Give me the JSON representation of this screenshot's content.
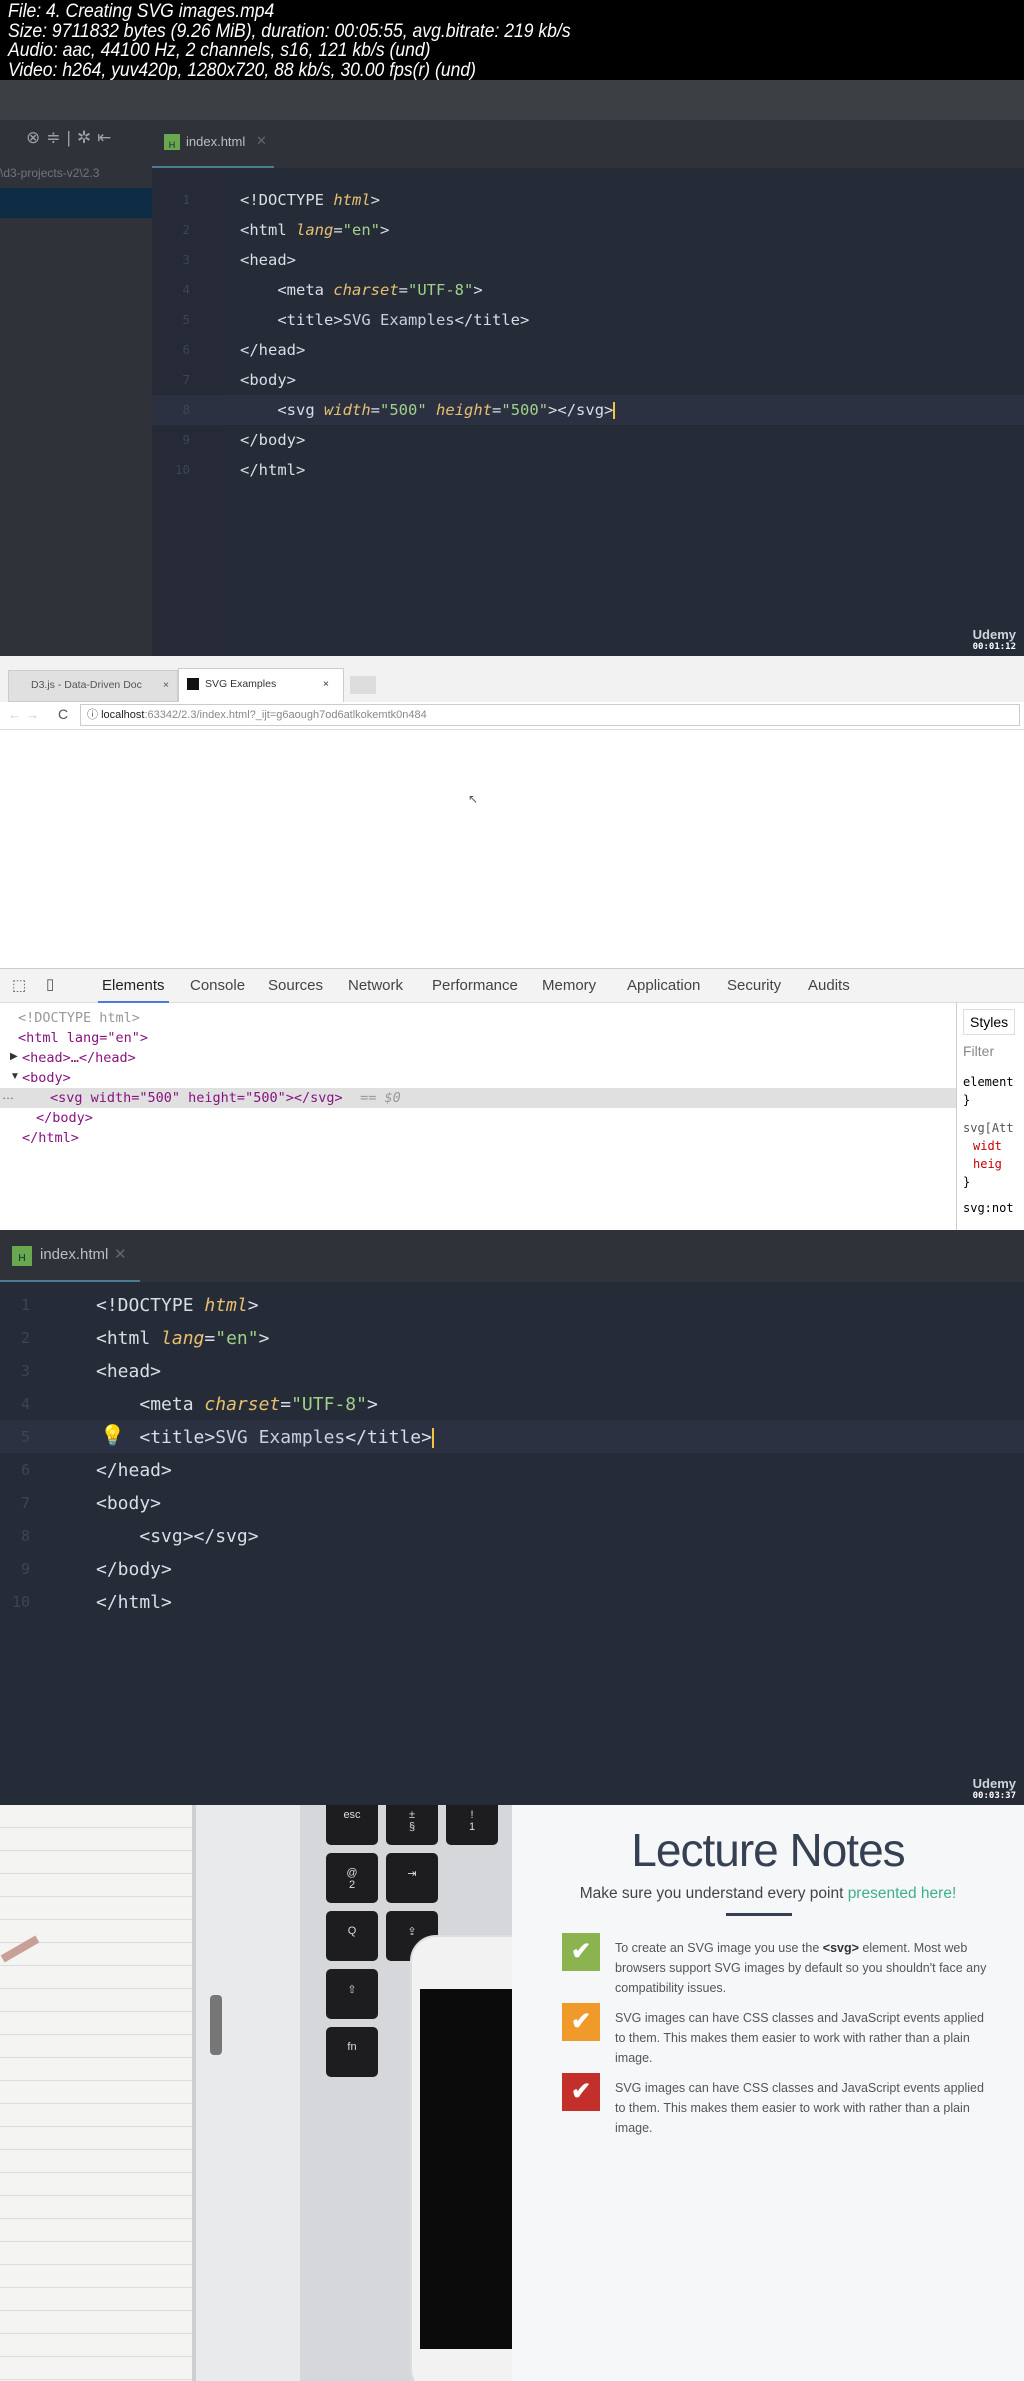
{
  "file_info": [
    "File: 4. Creating SVG images.mp4",
    "Size: 9711832 bytes (9.26 MiB), duration: 00:05:55, avg.bitrate: 219 kb/s",
    "Audio: aac, 44100 Hz, 2 channels, s16, 121 kb/s (und)",
    "Video: h264, yuv420p, 1280x720, 88 kb/s, 30.00 fps(r) (und)"
  ],
  "frame1": {
    "project_path": "\\d3-projects-v2\\2.3",
    "tab": "index.html",
    "timestamp": "00:01:12",
    "brand": "Udemy",
    "lines": [
      [
        [
          "tg",
          "<!DOCTYPE "
        ],
        [
          "at",
          "html"
        ],
        [
          "tg",
          ">"
        ]
      ],
      [
        [
          "tg",
          "<html "
        ],
        [
          "at",
          "lang"
        ],
        [
          "eq",
          "="
        ],
        [
          "st",
          "\"en\""
        ],
        [
          "tg",
          ">"
        ]
      ],
      [
        [
          "tg",
          "<head>"
        ]
      ],
      [
        [
          "tx",
          "    "
        ],
        [
          "tg",
          "<meta "
        ],
        [
          "at",
          "charset"
        ],
        [
          "eq",
          "="
        ],
        [
          "st",
          "\"UTF-8\""
        ],
        [
          "tg",
          ">"
        ]
      ],
      [
        [
          "tx",
          "    "
        ],
        [
          "tg",
          "<title>"
        ],
        [
          "tx",
          "SVG Examples"
        ],
        [
          "tg",
          "</title>"
        ]
      ],
      [
        [
          "tg",
          "</head>"
        ]
      ],
      [
        [
          "tg",
          "<body>"
        ]
      ],
      [
        [
          "tx",
          "    "
        ],
        [
          "tg",
          "<svg "
        ],
        [
          "at",
          "width"
        ],
        [
          "eq",
          "="
        ],
        [
          "st",
          "\"500\""
        ],
        [
          "tx",
          " "
        ],
        [
          "at",
          "height"
        ],
        [
          "eq",
          "="
        ],
        [
          "st",
          "\"500\""
        ],
        [
          "tg",
          "></svg>"
        ]
      ],
      [
        [
          "tg",
          "</body>"
        ]
      ],
      [
        [
          "tg",
          "</html>"
        ]
      ]
    ]
  },
  "frame2": {
    "tabs": [
      "D3.js - Data-Driven Doc",
      "SVG Examples"
    ],
    "url_host": "localhost",
    "url_rest": ":63342/2.3/index.html?_ijt=g6aough7od6atlkokemtk0n484",
    "devtools_tabs": [
      "Elements",
      "Console",
      "Sources",
      "Network",
      "Performance",
      "Memory",
      "Application",
      "Security",
      "Audits"
    ],
    "elements": {
      "doctype": "<!DOCTYPE html>",
      "html_open": "<html lang=\"en\">",
      "head": "<head>…</head>",
      "body_open": "<body>",
      "svg": "<svg width=\"500\" height=\"500\"></svg>",
      "svg_marker": " == $0",
      "body_close": "</body>",
      "html_close": "</html>"
    },
    "styles": {
      "tab": "Styles",
      "filter": "Filter",
      "element": "element",
      "brace": "}",
      "selector": "svg[Att",
      "prop1": "widt",
      "prop2": "heig",
      "next": "svg:not"
    }
  },
  "frame3": {
    "tab": "index.html",
    "timestamp": "00:03:37",
    "brand": "Udemy",
    "lines": [
      [
        [
          "tg",
          "<!DOCTYPE "
        ],
        [
          "at",
          "html"
        ],
        [
          "tg",
          ">"
        ]
      ],
      [
        [
          "tg",
          "<html "
        ],
        [
          "at",
          "lang"
        ],
        [
          "eq",
          "="
        ],
        [
          "st",
          "\"en\""
        ],
        [
          "tg",
          ">"
        ]
      ],
      [
        [
          "tg",
          "<head>"
        ]
      ],
      [
        [
          "tx",
          "    "
        ],
        [
          "tg",
          "<meta "
        ],
        [
          "at",
          "charset"
        ],
        [
          "eq",
          "="
        ],
        [
          "st",
          "\"UTF-8\""
        ],
        [
          "tg",
          ">"
        ]
      ],
      [
        [
          "tx",
          "    "
        ],
        [
          "tg",
          "<title>"
        ],
        [
          "tx",
          "SVG Examples"
        ],
        [
          "tg",
          "</title>"
        ]
      ],
      [
        [
          "tg",
          "</head>"
        ]
      ],
      [
        [
          "tg",
          "<body>"
        ]
      ],
      [
        [
          "tx",
          "    "
        ],
        [
          "tg",
          "<svg></svg>"
        ]
      ],
      [
        [
          "tg",
          "</body>"
        ]
      ],
      [
        [
          "tg",
          "</html>"
        ]
      ]
    ]
  },
  "frame4": {
    "title": "Lecture Notes",
    "subtitle": "Make sure you understand every point ",
    "subtitle_accent": "presented here!",
    "notes": [
      {
        "color": "#8bb34f",
        "pre": "To create an SVG image you use the ",
        "bold": "<svg>",
        "post": " element. Most web browsers support SVG images by default so you shouldn't face any compatibility issues."
      },
      {
        "color": "#ef9a2a",
        "pre": "SVG images can have CSS classes and JavaScript events applied to them. This makes them easier to work with rather than a plain image.",
        "bold": "",
        "post": ""
      },
      {
        "color": "#c3302c",
        "pre": "SVG images can have CSS classes and JavaScript events applied to them. This makes them easier to work with rather than a plain image.",
        "bold": "",
        "post": ""
      }
    ],
    "keys": [
      "esc",
      "±\n§",
      "!\n1",
      "@\n2",
      "⇥",
      "Q",
      "⇪",
      "⇧",
      "fn"
    ]
  }
}
